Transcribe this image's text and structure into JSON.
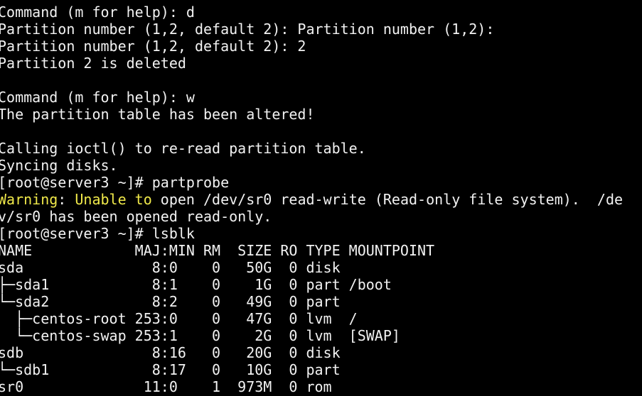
{
  "terminal": {
    "colors": {
      "background": "#000000",
      "foreground": "#f2f2f2",
      "warning": "#f0e94a"
    },
    "lines": [
      [
        {
          "text": "Command (m for help): d"
        }
      ],
      [
        {
          "text": "Partition number (1,2, default 2): Partition number (1,2):"
        }
      ],
      [
        {
          "text": "Partition number (1,2, default 2): 2"
        }
      ],
      [
        {
          "text": "Partition 2 is deleted"
        }
      ],
      [
        {
          "text": ""
        }
      ],
      [
        {
          "text": "Command (m for help): w"
        }
      ],
      [
        {
          "text": "The partition table has been altered!"
        }
      ],
      [
        {
          "text": ""
        }
      ],
      [
        {
          "text": "Calling ioctl() to re-read partition table."
        }
      ],
      [
        {
          "text": "Syncing disks."
        }
      ],
      [
        {
          "text": "[root@server3 ~]# partprobe"
        }
      ],
      [
        {
          "text": "Warning",
          "style": "warning"
        },
        {
          "text": ": "
        },
        {
          "text": "Unable to",
          "style": "warning"
        },
        {
          "text": " open /dev/sr0 read-write (Read-only file system).  /de"
        }
      ],
      [
        {
          "text": "v/sr0 has been opened read-only."
        }
      ],
      [
        {
          "text": "[root@server3 ~]# lsblk"
        }
      ],
      [
        {
          "text": "NAME            MAJ:MIN RM  SIZE RO TYPE MOUNTPOINT"
        }
      ],
      [
        {
          "text": "sda               8:0    0   50G  0 disk"
        }
      ],
      [
        {
          "text": "├─sda1            8:1    0    1G  0 part /boot"
        }
      ],
      [
        {
          "text": "└─sda2            8:2    0   49G  0 part"
        }
      ],
      [
        {
          "text": "  ├─centos-root 253:0    0   47G  0 lvm  /"
        }
      ],
      [
        {
          "text": "  └─centos-swap 253:1    0    2G  0 lvm  [SWAP]"
        }
      ],
      [
        {
          "text": "sdb               8:16   0   20G  0 disk"
        }
      ],
      [
        {
          "text": "└─sdb1            8:17   0   10G  0 part"
        }
      ],
      [
        {
          "text": "sr0              11:0    1  973M  0 rom"
        }
      ]
    ]
  }
}
